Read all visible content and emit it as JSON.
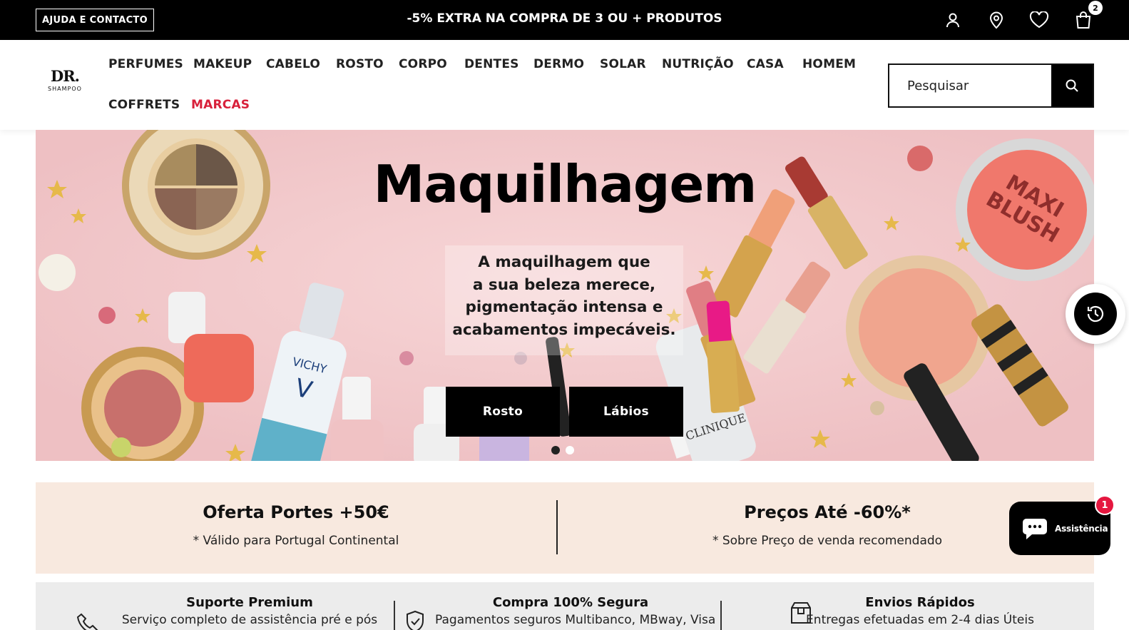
{
  "topbar": {
    "help_label": "AJUDA E CONTACTO",
    "promo_text": "-5% EXTRA NA COMPRA DE 3 OU + PRODUTOS",
    "icons": [
      "user-icon",
      "location-pin-icon",
      "heart-icon",
      "shopping-bag-icon"
    ],
    "cart_count": "2"
  },
  "header": {
    "logo": {
      "main": "DR.",
      "sub": "SHAMPOO"
    },
    "nav": [
      {
        "label": "PERFUMES"
      },
      {
        "label": "MAKEUP"
      },
      {
        "label": "CABELO"
      },
      {
        "label": "ROSTO"
      },
      {
        "label": "CORPO"
      },
      {
        "label": "DENTES"
      },
      {
        "label": "DERMO"
      },
      {
        "label": "SOLAR"
      },
      {
        "label": "NUTRIÇÃO"
      },
      {
        "label": "CASA"
      },
      {
        "label": "HOMEM"
      },
      {
        "label": "COFFRETS"
      },
      {
        "label": "MARCAS"
      }
    ],
    "search": {
      "placeholder": "Pesquisar",
      "value": ""
    }
  },
  "hero": {
    "title": "Maquilhagem",
    "text_lines": [
      "A maquilhagem que",
      "a sua beleza merece,",
      "pigmentação intensa e",
      "acabamentos impecáveis."
    ],
    "buttons": [
      {
        "label": "Rosto"
      },
      {
        "label": "Lábios"
      }
    ],
    "slides_total": 2,
    "active_slide": 1
  },
  "offers": [
    {
      "title": "Oferta Portes +50€",
      "subtitle": "* Válido para Portugal Continental"
    },
    {
      "title": "Preços Até -60%*",
      "subtitle": "* Sobre Preço de venda recomendado"
    }
  ],
  "chat": {
    "label": "Assistência",
    "badge": "1"
  },
  "features": [
    {
      "icon": "phone-icon",
      "title": "Suporte Premium",
      "text": "Serviço completo de assistência pré e pós"
    },
    {
      "icon": "shield-check-icon",
      "title": "Compra 100% Segura",
      "text": "Pagamentos seguros Multibanco, MBway, Visa"
    },
    {
      "icon": "box-icon",
      "title": "Envios Rápidos",
      "text": "Entregas efetuadas em 2-4 dias Úteis"
    }
  ],
  "colors": {
    "accent": "#d8213b",
    "hero_bg": "#f2c9cb",
    "offer_bg": "#f8e9df",
    "feature_bg": "#ececec",
    "badge": "#e5173f"
  }
}
